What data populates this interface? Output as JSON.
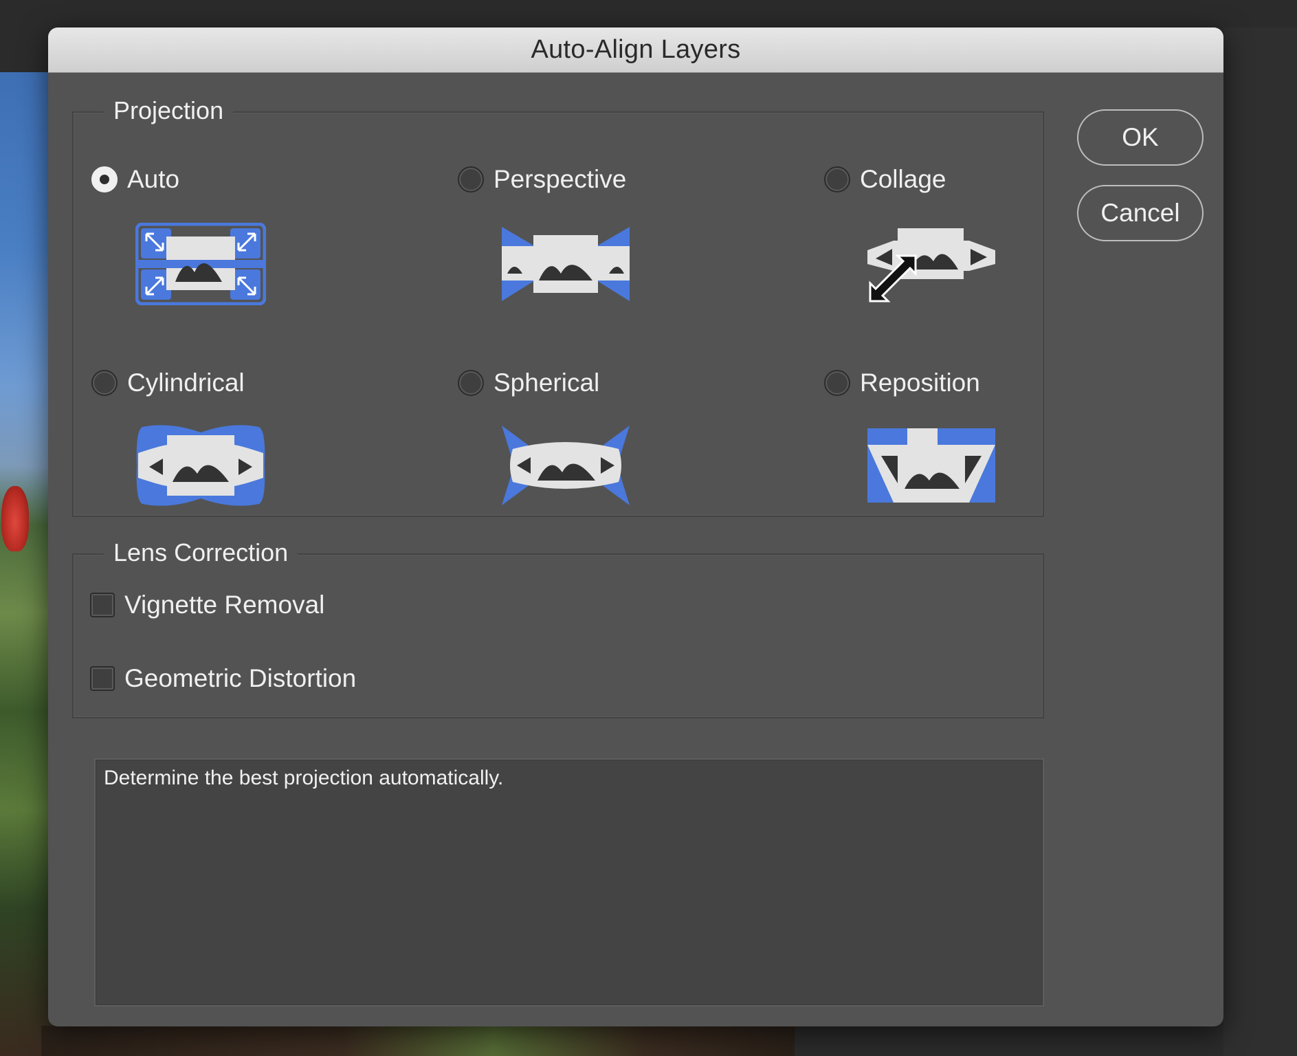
{
  "dialog": {
    "title": "Auto-Align Layers"
  },
  "projection": {
    "legend": "Projection",
    "selected": "Auto",
    "options": [
      {
        "label": "Auto",
        "checked": true,
        "icon": "auto-projection-icon"
      },
      {
        "label": "Perspective",
        "checked": false,
        "icon": "perspective-projection-icon"
      },
      {
        "label": "Collage",
        "checked": false,
        "icon": "collage-projection-icon"
      },
      {
        "label": "Cylindrical",
        "checked": false,
        "icon": "cylindrical-projection-icon"
      },
      {
        "label": "Spherical",
        "checked": false,
        "icon": "spherical-projection-icon"
      },
      {
        "label": "Reposition",
        "checked": false,
        "icon": "reposition-projection-icon"
      }
    ]
  },
  "lens": {
    "legend": "Lens Correction",
    "vignette_label": "Vignette Removal",
    "vignette_checked": false,
    "distortion_label": "Geometric Distortion",
    "distortion_checked": false
  },
  "description": "Determine the best projection automatically.",
  "buttons": {
    "ok": "OK",
    "cancel": "Cancel"
  },
  "colors": {
    "dialog_bg": "#535353",
    "accent_blue": "#4a78dc",
    "icon_gray": "#e3e3e3",
    "icon_dark": "#333333"
  }
}
